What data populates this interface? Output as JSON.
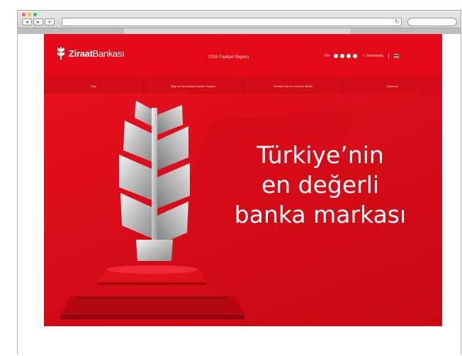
{
  "site": {
    "logo_brand": "Ziraat",
    "logo_suffix": "Bankası",
    "report_title": "2016 Faaliyet Raporu",
    "utils": {
      "language": "EN",
      "download": "Downloads"
    },
    "nav": [
      "Giriş",
      "Bilgi ve Sorumluluk Alanları Raporu",
      "Yönetim Kurulu & Genel Müdür",
      "Ekonomi"
    ],
    "headline": [
      "Türkiye’nin",
      "en değerli",
      "banka markası"
    ]
  },
  "colors": {
    "brand_red": "#e30a17",
    "nav_red": "#d10c18",
    "silver": "#c9c9c9",
    "white": "#ffffff"
  },
  "icons": [
    "wheat-logo-icon",
    "social-icon",
    "download-icon",
    "menu-icon",
    "reload-icon"
  ]
}
